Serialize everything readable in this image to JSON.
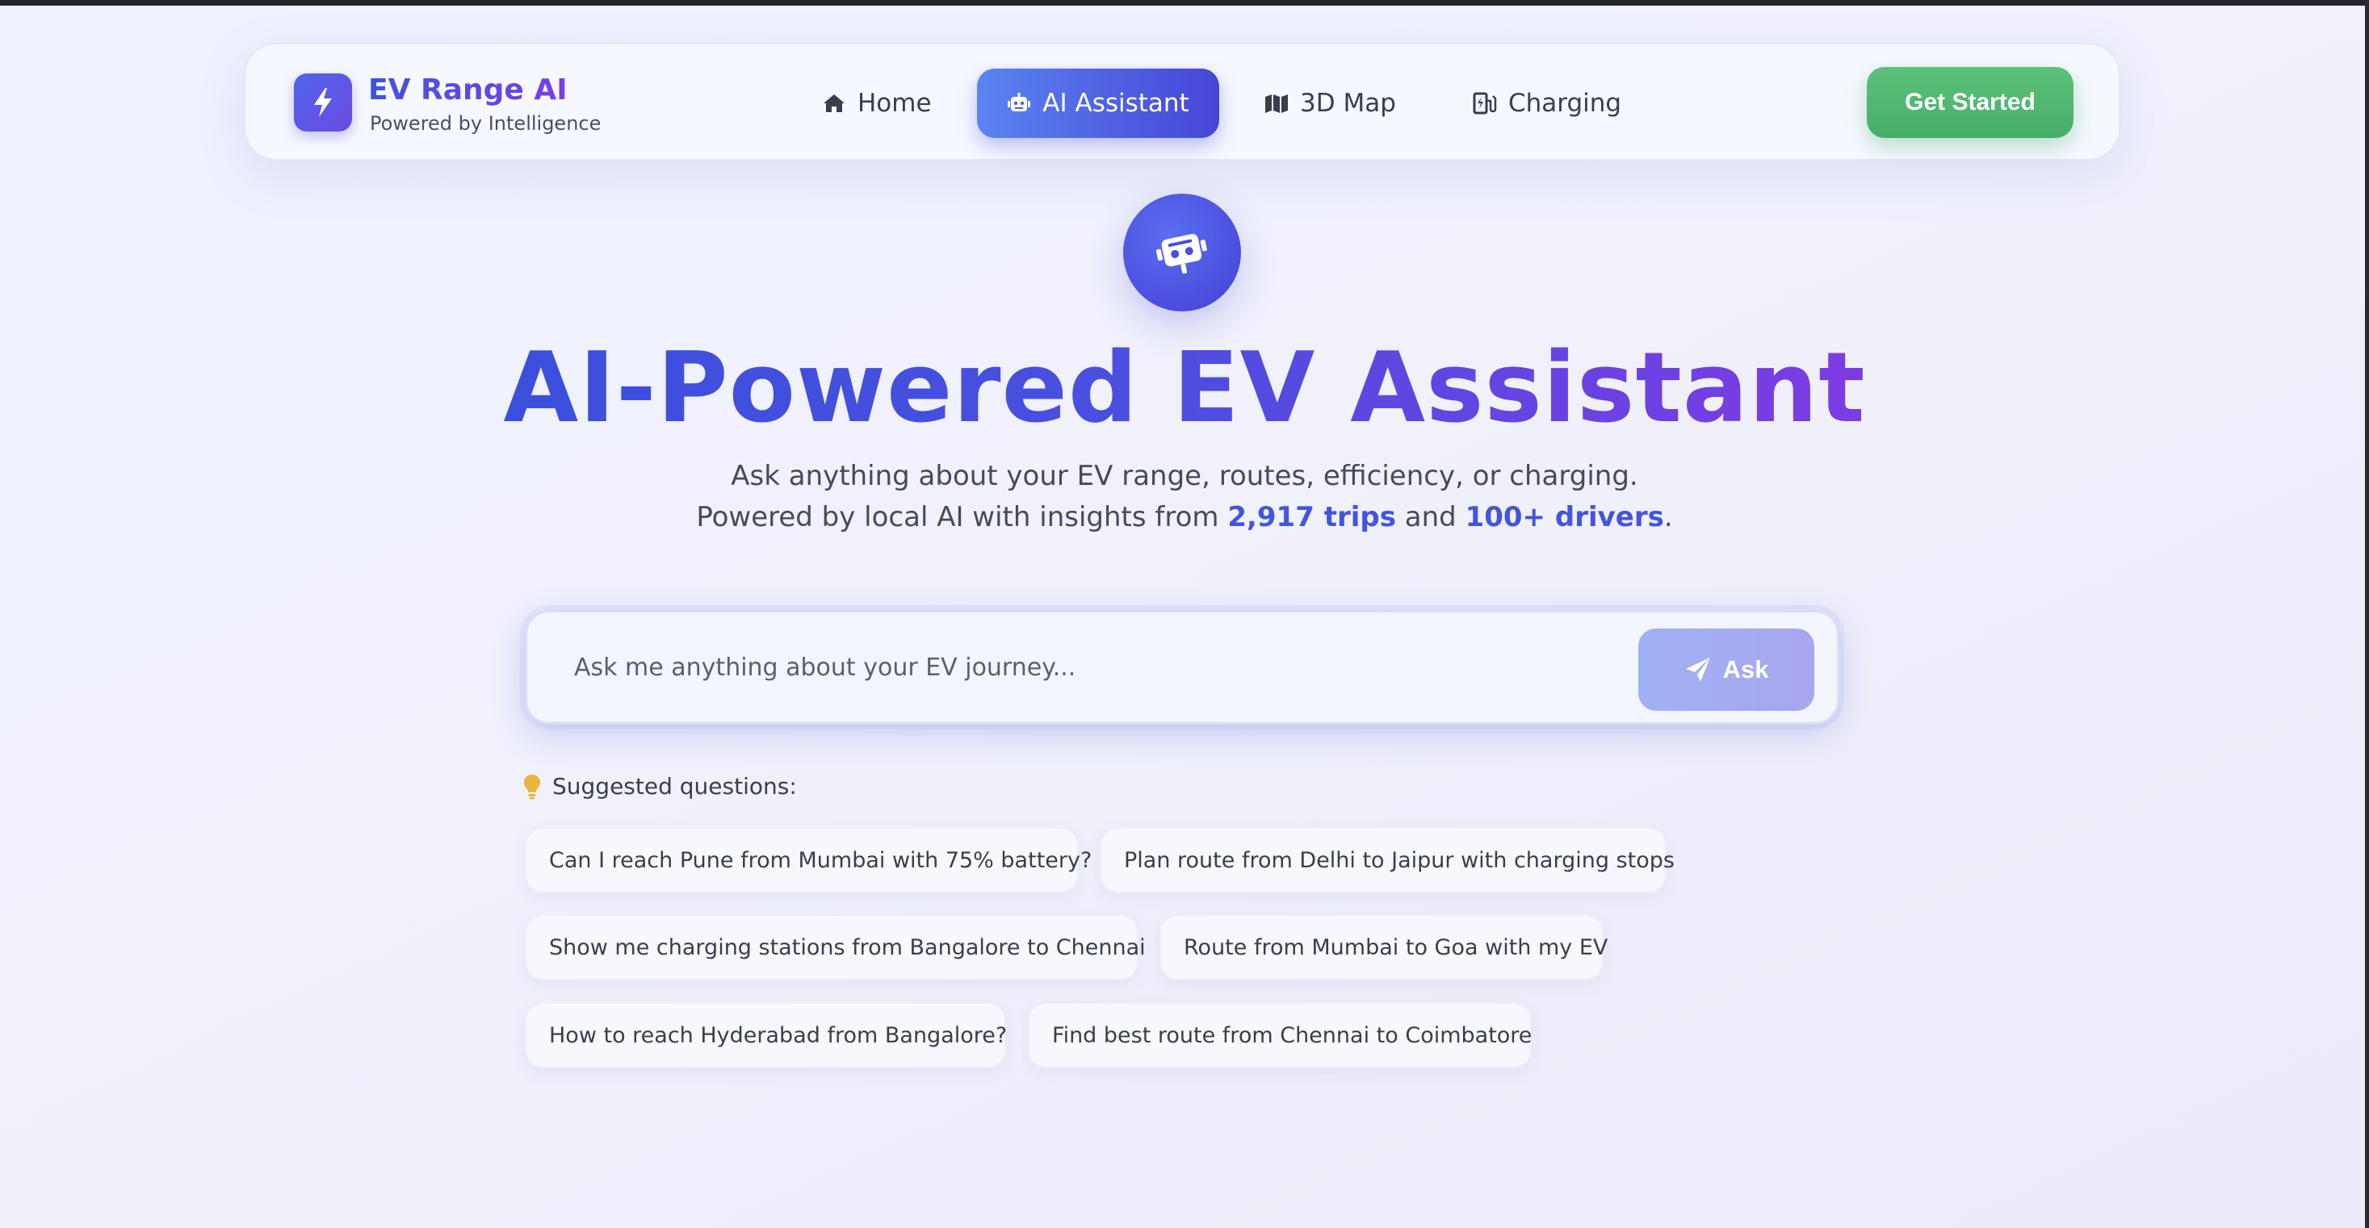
{
  "brand": {
    "name": "EV Range AI",
    "tagline": "Powered by Intelligence",
    "icon": "bolt-icon"
  },
  "nav": {
    "items": [
      {
        "label": "Home",
        "icon": "home-icon",
        "active": false
      },
      {
        "label": "AI Assistant",
        "icon": "robot-icon",
        "active": true
      },
      {
        "label": "3D Map",
        "icon": "map-icon",
        "active": false
      },
      {
        "label": "Charging",
        "icon": "charging-station-icon",
        "active": false
      }
    ],
    "cta_label": "Get Started"
  },
  "hero": {
    "icon": "robot-icon",
    "title": "AI-Powered EV Assistant",
    "subtitle_line1": "Ask anything about your EV range, routes, efficiency, or charging.",
    "subtitle_line2_prefix": "Powered by local AI with insights from ",
    "trips_stat": "2,917 trips",
    "subtitle_line2_mid": " and ",
    "drivers_stat": "100+ drivers",
    "subtitle_line2_suffix": "."
  },
  "search": {
    "placeholder": "Ask me anything about your EV journey...",
    "value": "",
    "button_label": "Ask",
    "button_icon": "paper-plane-icon"
  },
  "suggestions": {
    "title": "Suggested questions:",
    "icon": "lightbulb-icon",
    "items": [
      "Can I reach Pune from Mumbai with 75% battery?",
      "Plan route from Delhi to Jaipur with charging stops",
      "Show me charging stations from Bangalore to Chennai",
      "Route from Mumbai to Goa with my EV",
      "How to reach Hyderabad from Bangalore?",
      "Find best route from Chennai to Coimbatore"
    ]
  },
  "colors": {
    "accent": "#4a4fe0",
    "accent_purple": "#7d3be3",
    "cta_green": "#52b873",
    "stat_blue": "#4255dc"
  }
}
